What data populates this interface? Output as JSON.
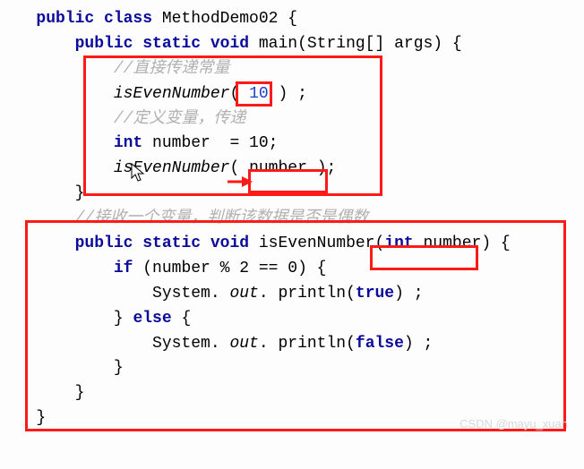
{
  "code": {
    "l1_kw1": "public class",
    "l1_name": " MethodDemo02 {",
    "l2_kw": "public static void",
    "l2_rest": " main(String[] args) {",
    "l3_comment": "//直接传递常量",
    "l4_call": "isEvenNumber",
    "l4_open": "(",
    "l4_arg": " 10 ",
    "l4_close": ") ;",
    "l5_comment": "//定义变量，传递",
    "l6_kw": "int",
    "l6_rest": " number  = 10;",
    "l7_call": "isEvenNumber",
    "l7_open": "(",
    "l7_arg": " number ",
    "l7_close": ");",
    "l8": "}",
    "l9_comment": "//接收一个变量，判断该数据是否是偶数",
    "l10_kw": "public static void",
    "l10_name": " isEvenNumber(",
    "l10_pkw": "int",
    "l10_pname": " number",
    "l10_close": ") {",
    "l11_kw": "if",
    "l11_cond": " (number % 2 == 0) {",
    "l12_sys": "System.",
    "l12_out": " out",
    "l12_print": ". println(",
    "l12_kw": "true",
    "l12_close": ") ;",
    "l13a": "} ",
    "l13_kw": "else",
    "l13b": " {",
    "l14_sys": "System.",
    "l14_out": " out",
    "l14_print": ". println(",
    "l14_kw": "false",
    "l14_close": ") ;",
    "l15": "}",
    "l16": "}",
    "l17": "}"
  },
  "watermark": "CSDN @mayu_xuan"
}
